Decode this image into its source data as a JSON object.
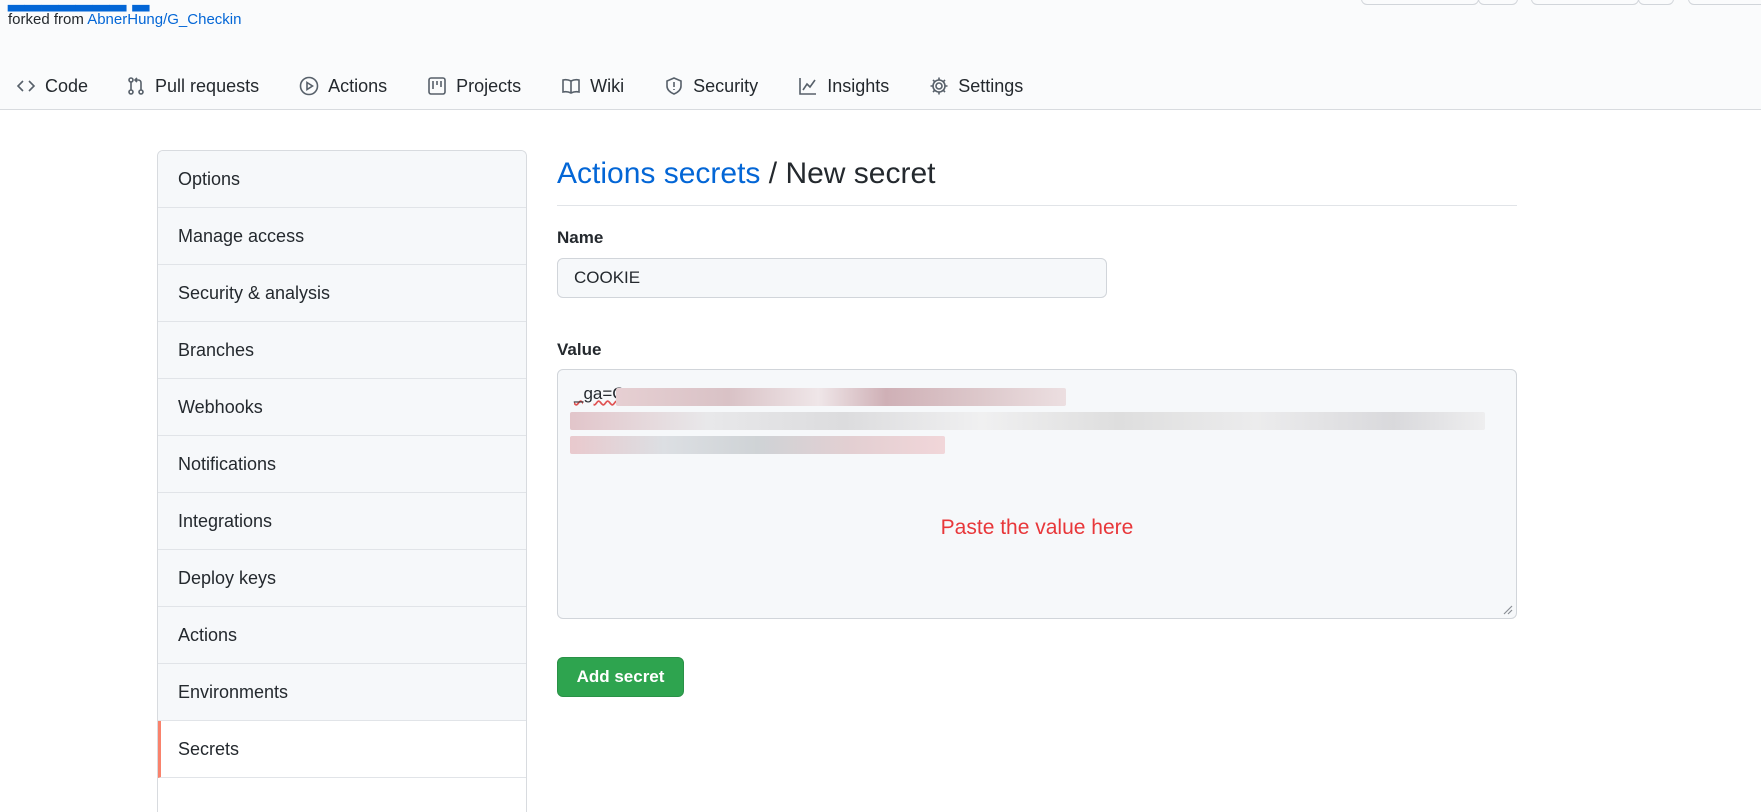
{
  "repo": {
    "forked_prefix": "forked from",
    "forked_link": "AbnerHung/G_Checkin"
  },
  "nav": {
    "tabs": [
      {
        "label": "Code",
        "icon": "code-icon"
      },
      {
        "label": "Pull requests",
        "icon": "pull-request-icon"
      },
      {
        "label": "Actions",
        "icon": "play-icon"
      },
      {
        "label": "Projects",
        "icon": "project-icon"
      },
      {
        "label": "Wiki",
        "icon": "book-icon"
      },
      {
        "label": "Security",
        "icon": "shield-icon"
      },
      {
        "label": "Insights",
        "icon": "graph-icon"
      },
      {
        "label": "Settings",
        "icon": "gear-icon"
      }
    ]
  },
  "sidebar": {
    "items": [
      {
        "label": "Options"
      },
      {
        "label": "Manage access"
      },
      {
        "label": "Security & analysis"
      },
      {
        "label": "Branches"
      },
      {
        "label": "Webhooks"
      },
      {
        "label": "Notifications"
      },
      {
        "label": "Integrations"
      },
      {
        "label": "Deploy keys"
      },
      {
        "label": "Actions"
      },
      {
        "label": "Environments"
      },
      {
        "label": "Secrets",
        "selected": true
      }
    ]
  },
  "main": {
    "breadcrumb_link": "Actions secrets",
    "breadcrumb_sep": " / ",
    "breadcrumb_current": "New secret",
    "name_label": "Name",
    "name_value": "COOKIE",
    "value_label": "Value",
    "value_prefix": "_ga=G",
    "value_hint": "Paste the value here",
    "submit_label": "Add secret"
  },
  "colors": {
    "link": "#0366d6",
    "primary_button": "#2ea44f",
    "hint_text": "#e8373a",
    "selected_indicator": "#f9826c"
  }
}
